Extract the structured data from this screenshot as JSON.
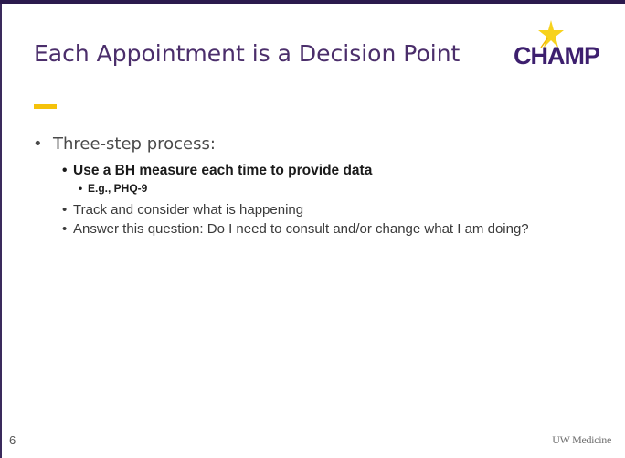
{
  "slide": {
    "title": "Each Appointment is a Decision Point",
    "logo": {
      "text": "CHAMP"
    },
    "bullets": {
      "main": "Three-step process:",
      "step1": "Use a BH measure each time to provide data",
      "step1_example": "E.g., PHQ-9",
      "step2": "Track and consider what is happening",
      "step3": "Answer this question: Do I need to consult and/or change what I am doing?"
    },
    "page_number": "6",
    "footer_brand": "UW Medicine"
  },
  "colors": {
    "title": "#4b2e6b",
    "accent": "#f5c20a",
    "logo": "#3d1f6e",
    "top_bar": "#2b1a4d"
  }
}
